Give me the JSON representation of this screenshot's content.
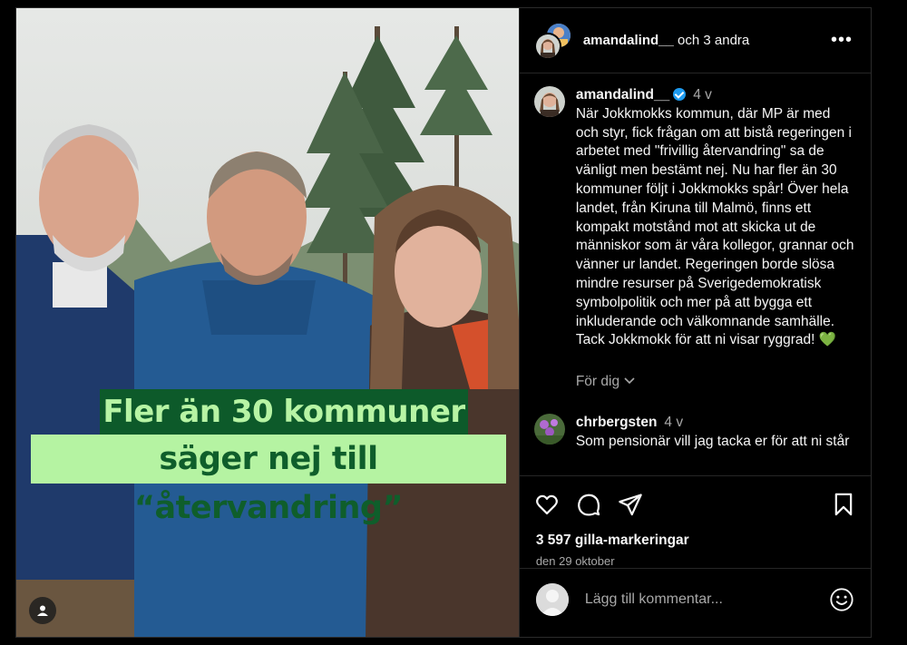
{
  "header": {
    "username": "amandalind__",
    "collab_suffix": "och 3 andra",
    "more_label": "•••"
  },
  "post": {
    "caption_line1": "Fler än 30 kommuner",
    "caption_line2": "säger nej till “återvandring”"
  },
  "comments": [
    {
      "username": "amandalind__",
      "verified": true,
      "time": "4 v",
      "text": "När Jokkmokks kommun, där MP är med och styr, fick frågan om att bistå regeringen i arbetet med \"frivillig återvandring\" sa de vänligt men bestämt nej. Nu har fler än 30 kommuner följt i Jokkmokks spår! Över hela landet, från Kiruna till Malmö, finns ett kompakt motstånd mot att skicka ut de människor som är våra kollegor, grannar och vänner ur landet. Regeringen borde slösa mindre resurser på Sverigedemokratisk symbolpolitik och mer på att bygga ett inkluderande och välkomnande samhälle. Tack Jokkmokk för att ni visar ryggrad!",
      "emoji": "💚"
    },
    {
      "username": "chrbergsten",
      "time": "4 v",
      "text": "Som pensionär vill jag tacka er för att ni står"
    }
  ],
  "for_you_label": "För dig",
  "likes": "3 597 gilla-markeringar",
  "date": "den 29 oktober",
  "add_comment_placeholder": "Lägg till kommentar...",
  "colors": {
    "caption_dark_bg": "#0d5a2a",
    "caption_light_bg": "#b5f3a2",
    "verified": "#1d9bf0"
  },
  "icons": [
    "heart-icon",
    "comment-icon",
    "share-icon",
    "bookmark-icon",
    "emoji-icon",
    "tagged-user-icon"
  ]
}
